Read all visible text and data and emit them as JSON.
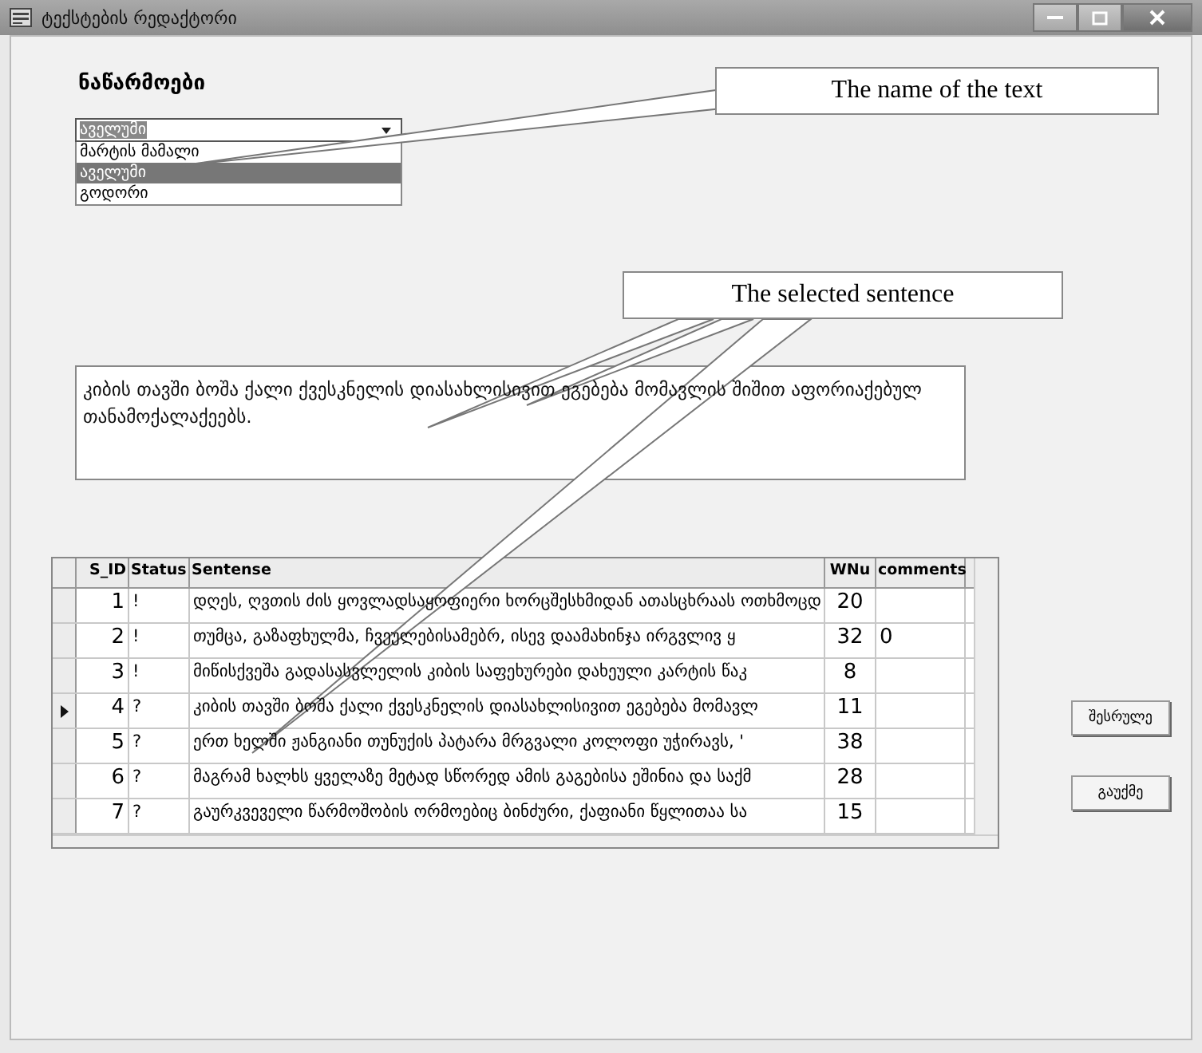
{
  "window": {
    "title": "ტექსტების რედაქტორი"
  },
  "heading": "ნაწარმოები",
  "dropdown": {
    "value": "აველუმი",
    "expanded": true,
    "options": [
      {
        "label": "მარტის მამალი",
        "selected": false
      },
      {
        "label": "აველუმი",
        "selected": true
      },
      {
        "label": "გოდორი",
        "selected": false
      }
    ]
  },
  "sentence_box": {
    "value": "კიბის თავში ბოშა ქალი ქვესკნელის დიასახლისივით ეგებება მომავლის შიშით აფორიაქებულ თანამოქალაქეებს."
  },
  "table": {
    "columns": [
      "S_ID",
      "Status",
      "Sentense",
      "WNu",
      "comments"
    ],
    "rows": [
      {
        "cells": [
          "1",
          "!",
          "დღეს, ღვთის ძის ყოვლადსაყოფიერი ხორცშესხმიდან ათასცხრაას ოთხმოცდ",
          "20",
          ""
        ],
        "selected": false
      },
      {
        "cells": [
          "2",
          "!",
          "თუმცა, გაზაფხულმა, ჩვეულებისამებრ, ისევ დაამახინჯა ირგვლივ ყ",
          "32",
          "0"
        ],
        "selected": false
      },
      {
        "cells": [
          "3",
          "!",
          "მიწისქვეშა გადასასვლელის კიბის საფეხურები დახეული კარტის წაკ",
          "8",
          ""
        ],
        "selected": false
      },
      {
        "cells": [
          "4",
          "?",
          "კიბის თავში ბოშა ქალი ქვესკნელის დიასახლისივით ეგებება მომავლ",
          "11",
          ""
        ],
        "selected": true
      },
      {
        "cells": [
          "5",
          "?",
          "ერთ ხელში ჟანგიანი თუნუქის პატარა მრგვალი კოლოფი უჭირავს, '",
          "38",
          ""
        ],
        "selected": false
      },
      {
        "cells": [
          "6",
          "?",
          "მაგრამ ხალხს ყველაზე მეტად სწორედ ამის გაგებისა ეშინია და საქმ",
          "28",
          ""
        ],
        "selected": false
      },
      {
        "cells": [
          "7",
          "?",
          " გაურკვეველი წარმოშობის ორმოებიც ბინძური, ქაფიანი წყლითაა სა",
          "15",
          ""
        ],
        "selected": false
      }
    ]
  },
  "buttons": [
    "შესრულე",
    "გაუქმე"
  ],
  "callouts": [
    {
      "text": "The name of the text"
    },
    {
      "text": "The selected sentence"
    }
  ]
}
